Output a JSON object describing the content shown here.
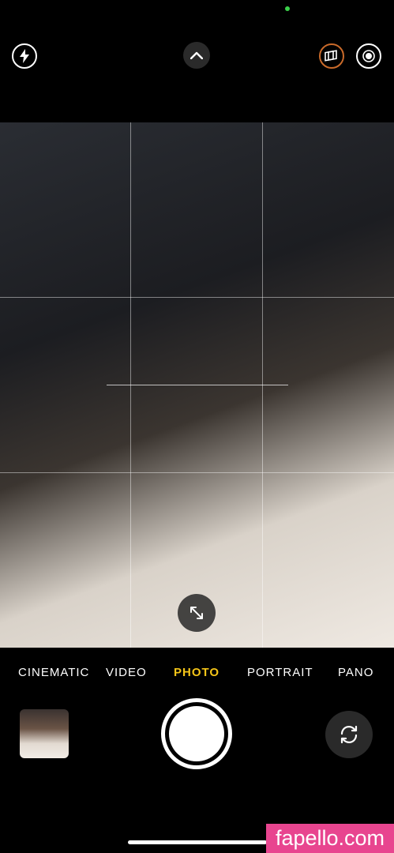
{
  "status": {
    "indicator_color": "#3bd14a"
  },
  "top_controls": {
    "flash_icon": "flash-icon",
    "chevron_icon": "chevron-up-icon",
    "styles_icon": "photographic-styles-icon",
    "live_icon": "live-photo-icon"
  },
  "viewfinder": {
    "expand_icon": "expand-arrows-icon"
  },
  "modes": [
    {
      "label": "CINEMATIC",
      "active": false
    },
    {
      "label": "VIDEO",
      "active": false
    },
    {
      "label": "PHOTO",
      "active": true
    },
    {
      "label": "PORTRAIT",
      "active": false
    },
    {
      "label": "PANO",
      "active": false
    }
  ],
  "bottom_controls": {
    "thumbnail_icon": "last-photo-thumbnail",
    "shutter_icon": "shutter-button",
    "flip_icon": "flip-camera-icon"
  },
  "colors": {
    "active_mode": "#f5c518",
    "watermark_bg": "#e8458f"
  },
  "watermark": {
    "text": "fapello.com"
  }
}
